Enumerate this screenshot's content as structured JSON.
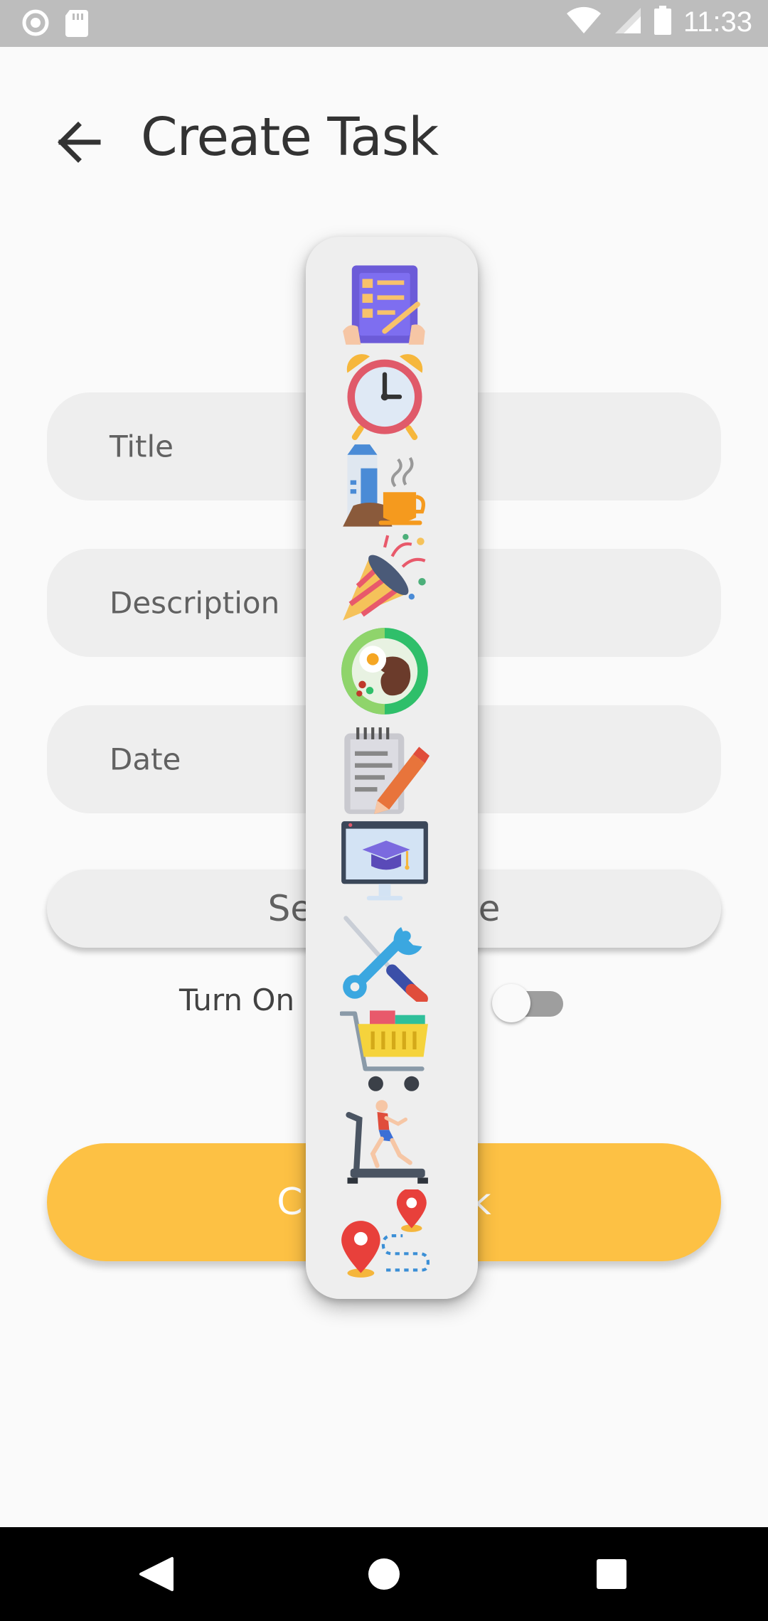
{
  "status_bar": {
    "time": "11:33",
    "icons": [
      "record-icon",
      "sd-card-icon",
      "wifi-icon",
      "signal-icon",
      "battery-icon"
    ]
  },
  "header": {
    "title": "Create Task",
    "back_icon": "arrow-back-icon"
  },
  "form": {
    "title_placeholder": "Title",
    "description_placeholder": "Description",
    "date_placeholder": "Date",
    "select_button_label": "Select Image",
    "notification_label": "Turn On Notification",
    "notification_enabled": false,
    "create_button_label": "Create Task"
  },
  "icon_picker": {
    "items": [
      "checklist-icon",
      "alarm-clock-icon",
      "breakfast-icon",
      "party-popper-icon",
      "meal-plate-icon",
      "notepad-pencil-icon",
      "online-education-icon",
      "tools-icon",
      "shopping-cart-icon",
      "treadmill-icon",
      "route-map-icon"
    ]
  },
  "nav_bar": {
    "icons": [
      "back-triangle-icon",
      "home-circle-icon",
      "recents-square-icon"
    ]
  },
  "colors": {
    "accent": "#fdc144",
    "field_bg": "#eeeeee",
    "status_bar": "#bdbdbd"
  }
}
